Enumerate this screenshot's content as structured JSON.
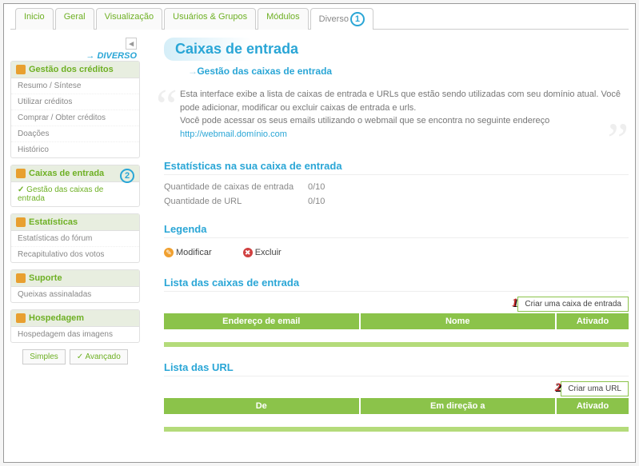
{
  "tabs": [
    "Inicio",
    "Geral",
    "Visualização",
    "Usuários & Grupos",
    "Módulos",
    "Diverso"
  ],
  "activeTab": 5,
  "navLabel": "DIVERSO",
  "sidebar": {
    "panels": [
      {
        "title": "Gestão dos créditos",
        "items": [
          "Resumo / Síntese",
          "Utilizar créditos",
          "Comprar / Obter créditos",
          "Doações",
          "Histórico"
        ]
      },
      {
        "title": "Caixas de entrada",
        "items": [
          "Gestão das caixas de entrada"
        ],
        "selected": 0,
        "badge": true
      },
      {
        "title": "Estatísticas",
        "items": [
          "Estatísticas do fórum",
          "Recapitulativo dos votos"
        ]
      },
      {
        "title": "Suporte",
        "items": [
          "Queixas assinaladas"
        ]
      },
      {
        "title": "Hospedagem",
        "items": [
          "Hospedagem das imagens"
        ]
      }
    ],
    "mode": {
      "simple": "Simples",
      "advanced": "Avançado"
    }
  },
  "page": {
    "title": "Caixas de entrada",
    "subtitle": "Gestão das caixas de entrada",
    "intro1": "Esta interface exibe a lista de caixas de entrada e URLs que estão sendo utilizadas com seu domínio atual. Você pode adicionar, modificar ou excluir caixas de entrada e urls.",
    "intro2": "Você pode acessar os seus emails utilizando o webmail que se encontra no seguinte endereço",
    "introLink": "http://webmail.domínio.com"
  },
  "stats": {
    "heading": "Estatísticas na sua caixa de entrada",
    "r1k": "Quantidade de caixas de entrada",
    "r1v": "0/10",
    "r2k": "Quantidade de URL",
    "r2v": "0/10"
  },
  "legend": {
    "heading": "Legenda",
    "mod": "Modificar",
    "del": "Excluir"
  },
  "list1": {
    "heading": "Lista das caixas de entrada",
    "create": "Criar uma caixa de entrada",
    "cols": [
      "Endereço de email",
      "Nome",
      "Ativado"
    ]
  },
  "list2": {
    "heading": "Lista das URL",
    "create": "Criar uma URL",
    "cols": [
      "De",
      "Em direção a",
      "Ativado"
    ]
  }
}
